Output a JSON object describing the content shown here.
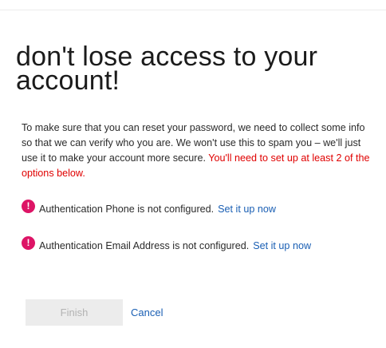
{
  "page": {
    "title": "don't lose access to your account!",
    "intro_text": "To make sure that you can reset your password, we need to collect some info so that we can verify who you are. We won't use this to spam you – we'll just use it to make your account more secure.",
    "intro_warning": "You'll need to set up at least 2 of the options below."
  },
  "options": [
    {
      "icon": "alert-icon",
      "icon_glyph": "!",
      "message": "Authentication Phone is not configured.",
      "link_label": "Set it up now"
    },
    {
      "icon": "alert-icon",
      "icon_glyph": "!",
      "message": "Authentication Email Address is not configured.",
      "link_label": "Set it up now"
    }
  ],
  "actions": {
    "finish_label": "Finish",
    "cancel_label": "Cancel"
  },
  "colors": {
    "warning_text": "#e00000",
    "alert_icon": "#dd1466",
    "link": "#1a5fb4",
    "disabled_button_bg": "#ececec",
    "disabled_button_text": "#b3b3b3"
  }
}
